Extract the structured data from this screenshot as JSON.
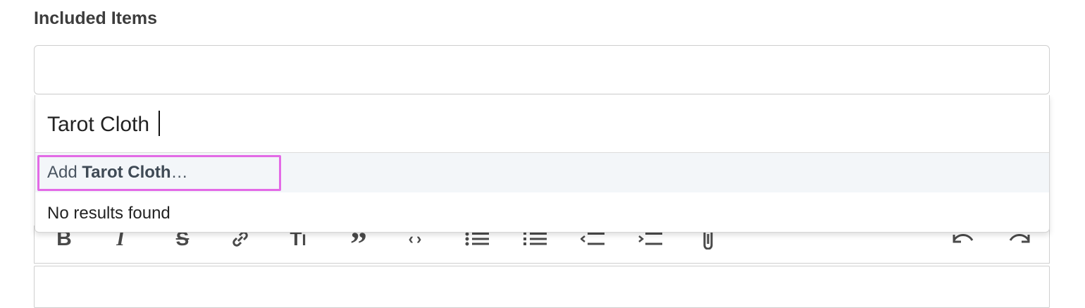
{
  "form": {
    "section_label": "Included Items"
  },
  "tag_select": {
    "search_value": "Tarot Cloth",
    "add_option": {
      "prefix": "Add",
      "term": "Tarot Cloth",
      "suffix": "…"
    },
    "empty_message": "No results found"
  },
  "toolbar": {
    "buttons": [
      {
        "name": "bold",
        "icon": "bold-icon"
      },
      {
        "name": "italic",
        "icon": "italic-icon"
      },
      {
        "name": "strikethrough",
        "icon": "strikethrough-icon"
      },
      {
        "name": "link",
        "icon": "link-icon"
      },
      {
        "name": "heading",
        "icon": "heading-icon"
      },
      {
        "name": "quote",
        "icon": "quote-icon"
      },
      {
        "name": "code",
        "icon": "code-icon"
      },
      {
        "name": "bullet-list",
        "icon": "bullet-list-icon"
      },
      {
        "name": "numbered-list",
        "icon": "numbered-list-icon"
      },
      {
        "name": "decrease-indent",
        "icon": "outdent-icon"
      },
      {
        "name": "increase-indent",
        "icon": "indent-icon"
      },
      {
        "name": "attach-files",
        "icon": "paperclip-icon"
      },
      {
        "name": "undo",
        "icon": "undo-icon"
      },
      {
        "name": "redo",
        "icon": "redo-icon"
      }
    ]
  },
  "colors": {
    "highlight": "#e36ae6",
    "option_hover_bg": "#f3f6f9"
  }
}
